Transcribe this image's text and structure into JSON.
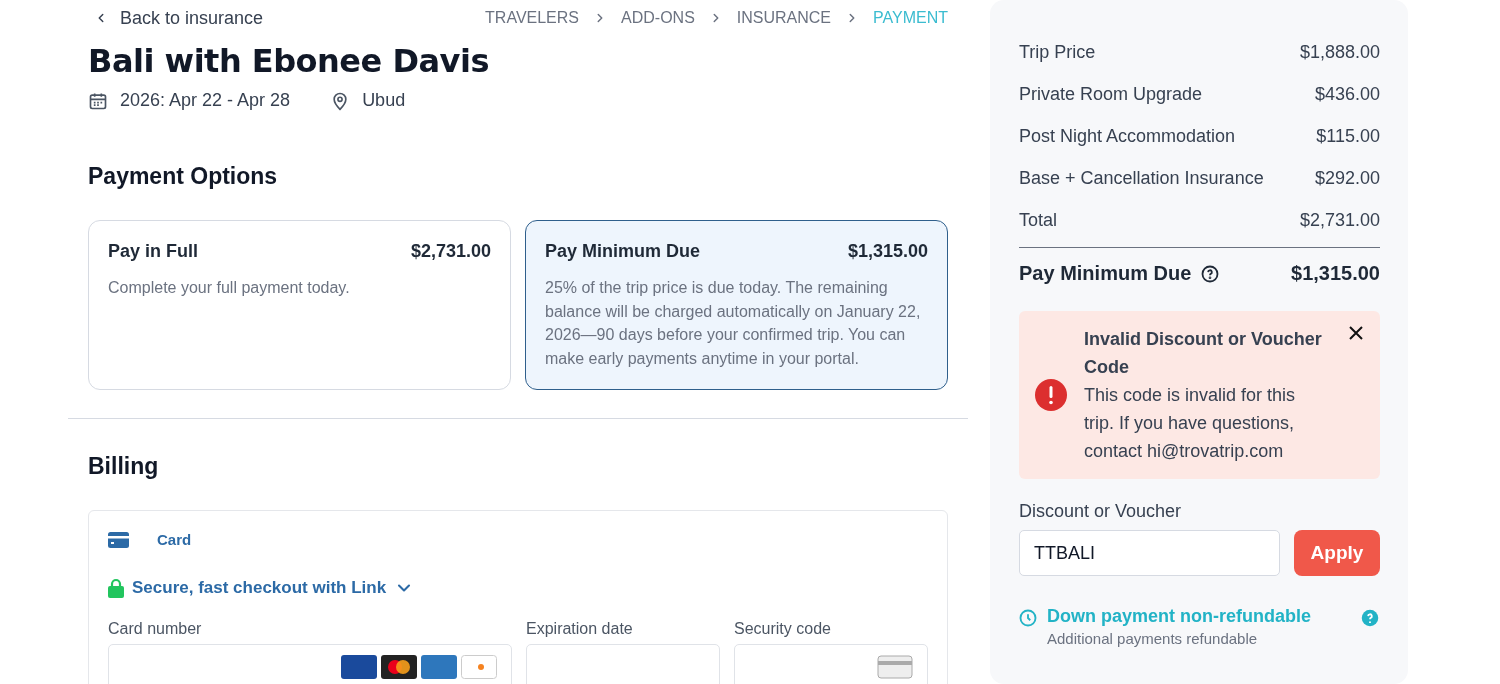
{
  "back_link": {
    "label": "Back to insurance"
  },
  "steps": [
    {
      "label": "TRAVELERS",
      "selected": false
    },
    {
      "label": "ADD-ONS",
      "selected": false
    },
    {
      "label": "INSURANCE",
      "selected": false
    },
    {
      "label": "PAYMENT",
      "selected": true
    }
  ],
  "trip": {
    "title": "Bali with Ebonee Davis",
    "dates": "2026: Apr 22 - Apr 28",
    "location": "Ubud"
  },
  "payment_options": {
    "heading": "Payment Options",
    "options": [
      {
        "title": "Pay in Full",
        "amount": "$2,731.00",
        "description": "Complete your full payment today.",
        "selected": false
      },
      {
        "title": "Pay Minimum Due",
        "amount": "$1,315.00",
        "description": "25% of the trip price is due today. The remaining balance will be charged automatically on January 22, 2026—90 days before your confirmed trip. You can make early payments anytime in your portal.",
        "selected": true
      }
    ]
  },
  "billing": {
    "heading": "Billing",
    "method": {
      "label": "Card"
    },
    "link_checkout": "Secure, fast checkout with Link",
    "fields": [
      {
        "kind": "card",
        "label": "Card number"
      },
      {
        "kind": "plain",
        "label": "Expiration date"
      },
      {
        "kind": "cvc",
        "label": "Security code"
      }
    ]
  },
  "summary": {
    "lines": [
      {
        "label": "Trip Price",
        "amount": "$1,888.00"
      },
      {
        "label": "Private Room Upgrade",
        "amount": "$436.00"
      },
      {
        "label": "Post Night Accommodation",
        "amount": "$115.00"
      },
      {
        "label": "Base + Cancellation Insurance",
        "amount": "$292.00"
      },
      {
        "label": "Total",
        "amount": "$2,731.00"
      }
    ],
    "due": {
      "label": "Pay Minimum Due",
      "amount": "$1,315.00"
    },
    "alert": {
      "title": "Invalid Discount or Voucher Code",
      "message": "This code is invalid for this trip. If you have questions, contact hi@trovatrip.com"
    },
    "discount": {
      "label": "Discount or Voucher",
      "value": "TTBALI",
      "button": "Apply"
    },
    "note": {
      "title": "Down payment non-refundable",
      "subtitle": "Additional payments refundable"
    }
  }
}
